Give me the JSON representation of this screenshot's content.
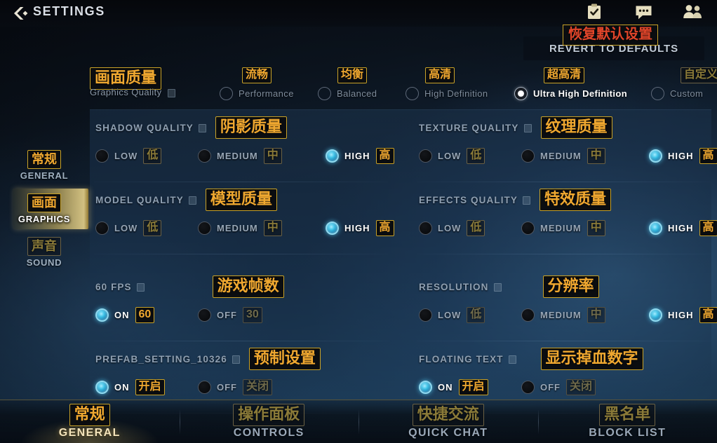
{
  "header": {
    "back_icon": "chevron-left-icon",
    "title": "SETTINGS",
    "icons": [
      {
        "name": "checklist-icon",
        "glyph": "clipboard"
      },
      {
        "name": "chat-bubble-icon",
        "glyph": "chat"
      },
      {
        "name": "friends-icon",
        "glyph": "people"
      }
    ]
  },
  "revert": {
    "label": "REVERT TO DEFAULTS",
    "cn": "恢复默认设置"
  },
  "sidebar": {
    "items": [
      {
        "cn": "常规",
        "en": "GENERAL",
        "active": false
      },
      {
        "cn": "画面",
        "en": "GRAPHICS",
        "active": true
      },
      {
        "cn": "声音",
        "en": "SOUND",
        "active": false
      }
    ]
  },
  "preset_row": {
    "title": {
      "en": "Graphics Quality",
      "cn": "画面质量"
    },
    "options": [
      {
        "en": "Performance",
        "cn": "流畅",
        "selected": false
      },
      {
        "en": "Balanced",
        "cn": "均衡",
        "selected": false
      },
      {
        "en": "High Definition",
        "cn": "高清",
        "selected": false
      },
      {
        "en": "Ultra High Definition",
        "cn": "超高清",
        "selected": true
      },
      {
        "en": "Custom",
        "cn": "自定义",
        "selected": false
      }
    ]
  },
  "settings": [
    {
      "title": "SHADOW QUALITY",
      "cn": "阴影质量",
      "options": [
        {
          "label": "LOW",
          "cn": "低",
          "selected": false
        },
        {
          "label": "MEDIUM",
          "cn": "中",
          "selected": false
        },
        {
          "label": "HIGH",
          "cn": "高",
          "selected": true
        }
      ]
    },
    {
      "title": "TEXTURE QUALITY",
      "cn": "纹理质量",
      "options": [
        {
          "label": "LOW",
          "cn": "低",
          "selected": false
        },
        {
          "label": "MEDIUM",
          "cn": "中",
          "selected": false
        },
        {
          "label": "HIGH",
          "cn": "高",
          "selected": true
        }
      ]
    },
    {
      "title": "MODEL QUALITY",
      "cn": "模型质量",
      "options": [
        {
          "label": "LOW",
          "cn": "低",
          "selected": false
        },
        {
          "label": "MEDIUM",
          "cn": "中",
          "selected": false
        },
        {
          "label": "HIGH",
          "cn": "高",
          "selected": true
        }
      ]
    },
    {
      "title": "EFFECTS QUALITY",
      "cn": "特效质量",
      "options": [
        {
          "label": "LOW",
          "cn": "低",
          "selected": false
        },
        {
          "label": "MEDIUM",
          "cn": "中",
          "selected": false
        },
        {
          "label": "HIGH",
          "cn": "高",
          "selected": true
        }
      ]
    },
    {
      "title": "60 FPS",
      "cn": "游戏帧数",
      "options": [
        {
          "label": "ON",
          "cn": "60",
          "selected": true
        },
        {
          "label": "OFF",
          "cn": "30",
          "selected": false
        }
      ]
    },
    {
      "title": "RESOLUTION",
      "cn": "分辨率",
      "options": [
        {
          "label": "LOW",
          "cn": "低",
          "selected": false
        },
        {
          "label": "MEDIUM",
          "cn": "中",
          "selected": false
        },
        {
          "label": "HIGH",
          "cn": "高",
          "selected": true
        }
      ]
    },
    {
      "title": "PREFAB_SETTING_10326",
      "cn": "预制设置",
      "options": [
        {
          "label": "ON",
          "cn": "开启",
          "selected": true
        },
        {
          "label": "OFF",
          "cn": "关闭",
          "selected": false
        }
      ]
    },
    {
      "title": "FLOATING TEXT",
      "cn": "显示掉血数字",
      "options": [
        {
          "label": "ON",
          "cn": "开启",
          "selected": true
        },
        {
          "label": "OFF",
          "cn": "关闭",
          "selected": false
        }
      ]
    }
  ],
  "bottom_nav": [
    {
      "cn": "常规",
      "en": "GENERAL",
      "active": true
    },
    {
      "cn": "操作面板",
      "en": "CONTROLS",
      "active": false
    },
    {
      "cn": "快捷交流",
      "en": "QUICK CHAT",
      "active": false
    },
    {
      "cn": "黑名单",
      "en": "BLOCK LIST",
      "active": false
    }
  ],
  "colors": {
    "accent_gold": "#f0a830",
    "accent_border": "#c9a227",
    "radio_on": "#3fc4e8",
    "revert_red": "#e0452a",
    "panel_bg": "#1a3048"
  }
}
